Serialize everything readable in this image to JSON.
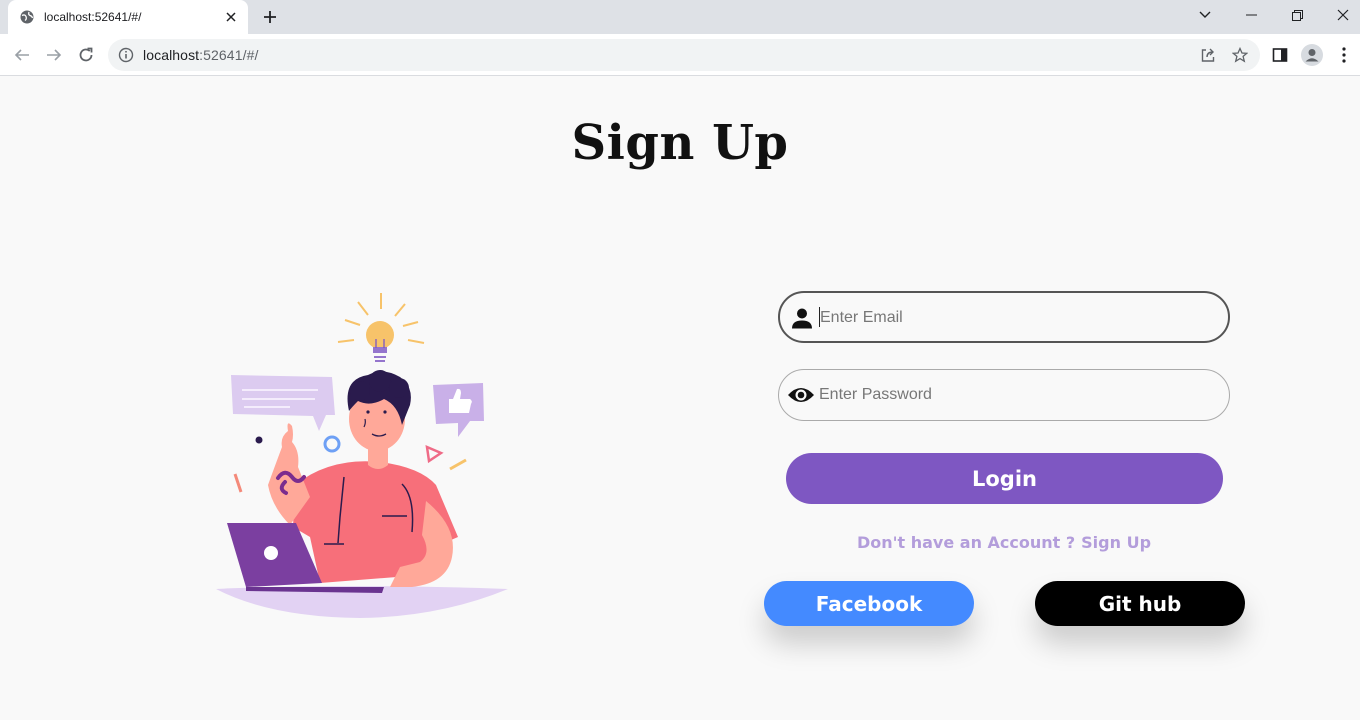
{
  "browser": {
    "tab_title": "localhost:52641/#/",
    "url_host": "localhost",
    "url_path": ":52641/#/"
  },
  "page": {
    "title": "Sign Up"
  },
  "form": {
    "email_placeholder": "Enter Email",
    "password_placeholder": "Enter Password",
    "login_label": "Login",
    "no_account_text": "Don't have an Account ?",
    "signup_link": "Sign Up",
    "facebook_label": "Facebook",
    "github_label": "Git hub"
  },
  "colors": {
    "login_button": "#7e57c2",
    "facebook_button": "#448aff",
    "github_button": "#000000",
    "signup_text": "#b39ddb"
  },
  "icons": {
    "email_field": "person-icon",
    "password_field": "eye-icon"
  }
}
